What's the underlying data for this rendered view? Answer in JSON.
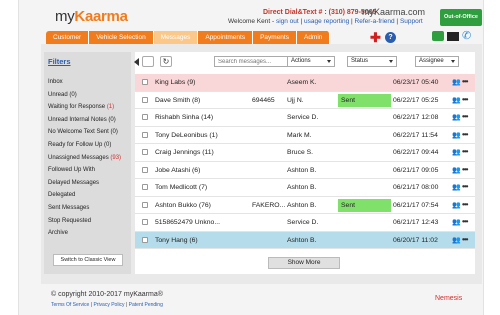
{
  "header": {
    "logo_my": "my",
    "logo_kaarma": "Kaarma",
    "direct_dial": "Direct Dial&Text # : (310) 879-5005",
    "domain": "myKaarma.com",
    "welcome": "Welcome Kent -",
    "links": [
      "sign out",
      "usage reporting",
      "Refer-a-friend",
      "Support"
    ],
    "out_of_office": "Out-of-Office"
  },
  "nav": {
    "tabs": [
      {
        "label": "Customer",
        "active": false
      },
      {
        "label": "Vehicle Selection",
        "active": false
      },
      {
        "label": "Messages",
        "active": true
      },
      {
        "label": "Appointments",
        "active": false
      },
      {
        "label": "Payments",
        "active": false
      },
      {
        "label": "Admin",
        "active": false
      }
    ],
    "icons": [
      "plus-icon",
      "help-icon",
      "chat-icon",
      "mail-icon",
      "phone-icon"
    ]
  },
  "filters": {
    "title": "Filters",
    "items": [
      {
        "label": "Inbox",
        "count": ""
      },
      {
        "label": "Unread",
        "count": "(0)"
      },
      {
        "label": "Waiting for Response",
        "count": "(1)",
        "red": true
      },
      {
        "label": "Unread Internal Notes",
        "count": "(0)"
      },
      {
        "label": "No Welcome Text Sent",
        "count": "(0)"
      },
      {
        "label": "Ready for Follow Up",
        "count": "(0)"
      },
      {
        "label": "Unassigned Messages",
        "count": "(93)",
        "red": true
      },
      {
        "label": "Followed Up With",
        "count": ""
      },
      {
        "label": "Delayed Messages",
        "count": ""
      },
      {
        "label": "Delegated",
        "count": ""
      },
      {
        "label": "Sent Messages",
        "count": ""
      },
      {
        "label": "Stop Requested",
        "count": ""
      },
      {
        "label": "Archive",
        "count": ""
      }
    ],
    "classic_button": "Switch to Classic View"
  },
  "toolbar": {
    "refresh_glyph": "↻",
    "search_placeholder": "Search messages...",
    "actions": "Actions",
    "status": "Status",
    "assignee": "Assignee"
  },
  "messages": [
    {
      "name": "King Labs (9)",
      "info": "",
      "assoc": "Aseem K.",
      "status": "",
      "date": "06/23/17 05:40",
      "highlight": "pink"
    },
    {
      "name": "Dave Smith (8)",
      "info": "694465",
      "assoc": "Ujj N.",
      "status": "Sent",
      "date": "06/22/17 05:25",
      "highlight": ""
    },
    {
      "name": "Rishabh Sinha (14)",
      "info": "",
      "assoc": "Service D.",
      "status": "",
      "date": "06/22/17 12:08",
      "highlight": ""
    },
    {
      "name": "Tony DeLeonibus (1)",
      "info": "",
      "assoc": "Mark M.",
      "status": "",
      "date": "06/22/17 11:54",
      "highlight": ""
    },
    {
      "name": "Craig Jennings (11)",
      "info": "",
      "assoc": "Bruce S.",
      "status": "",
      "date": "06/22/17 09:44",
      "highlight": ""
    },
    {
      "name": "Jobe Atashi (6)",
      "info": "",
      "assoc": "Ashton B.",
      "status": "",
      "date": "06/21/17 09:05",
      "highlight": ""
    },
    {
      "name": "Tom Medlicott (7)",
      "info": "",
      "assoc": "Ashton B.",
      "status": "",
      "date": "06/21/17 08:00",
      "highlight": ""
    },
    {
      "name": "Ashton Bukko (76)",
      "info": "FAKERO...",
      "assoc": "Ashton B.",
      "status": "Sent",
      "date": "06/21/17 07:54",
      "highlight": ""
    },
    {
      "name": "5158652479 Unkno...",
      "info": "",
      "assoc": "Service D.",
      "status": "",
      "date": "06/21/17 12:43",
      "highlight": ""
    },
    {
      "name": "Tony Hang (6)",
      "info": "",
      "assoc": "Ashton B.",
      "status": "",
      "date": "06/20/17 11:02",
      "highlight": "blue"
    }
  ],
  "show_more": "Show More",
  "footer": {
    "copyright": "© copyright 2010-2017 myKaarma®",
    "links": [
      "Terms Of Service",
      "Privacy Policy",
      "Patent Pending"
    ],
    "nemesis": "Nemesis"
  },
  "colors": {
    "accent": "#f07c1e",
    "link": "#2a5db0",
    "status_green": "#7fe06a",
    "row_pink": "#f9d6d8",
    "row_blue": "#b5dcea"
  }
}
